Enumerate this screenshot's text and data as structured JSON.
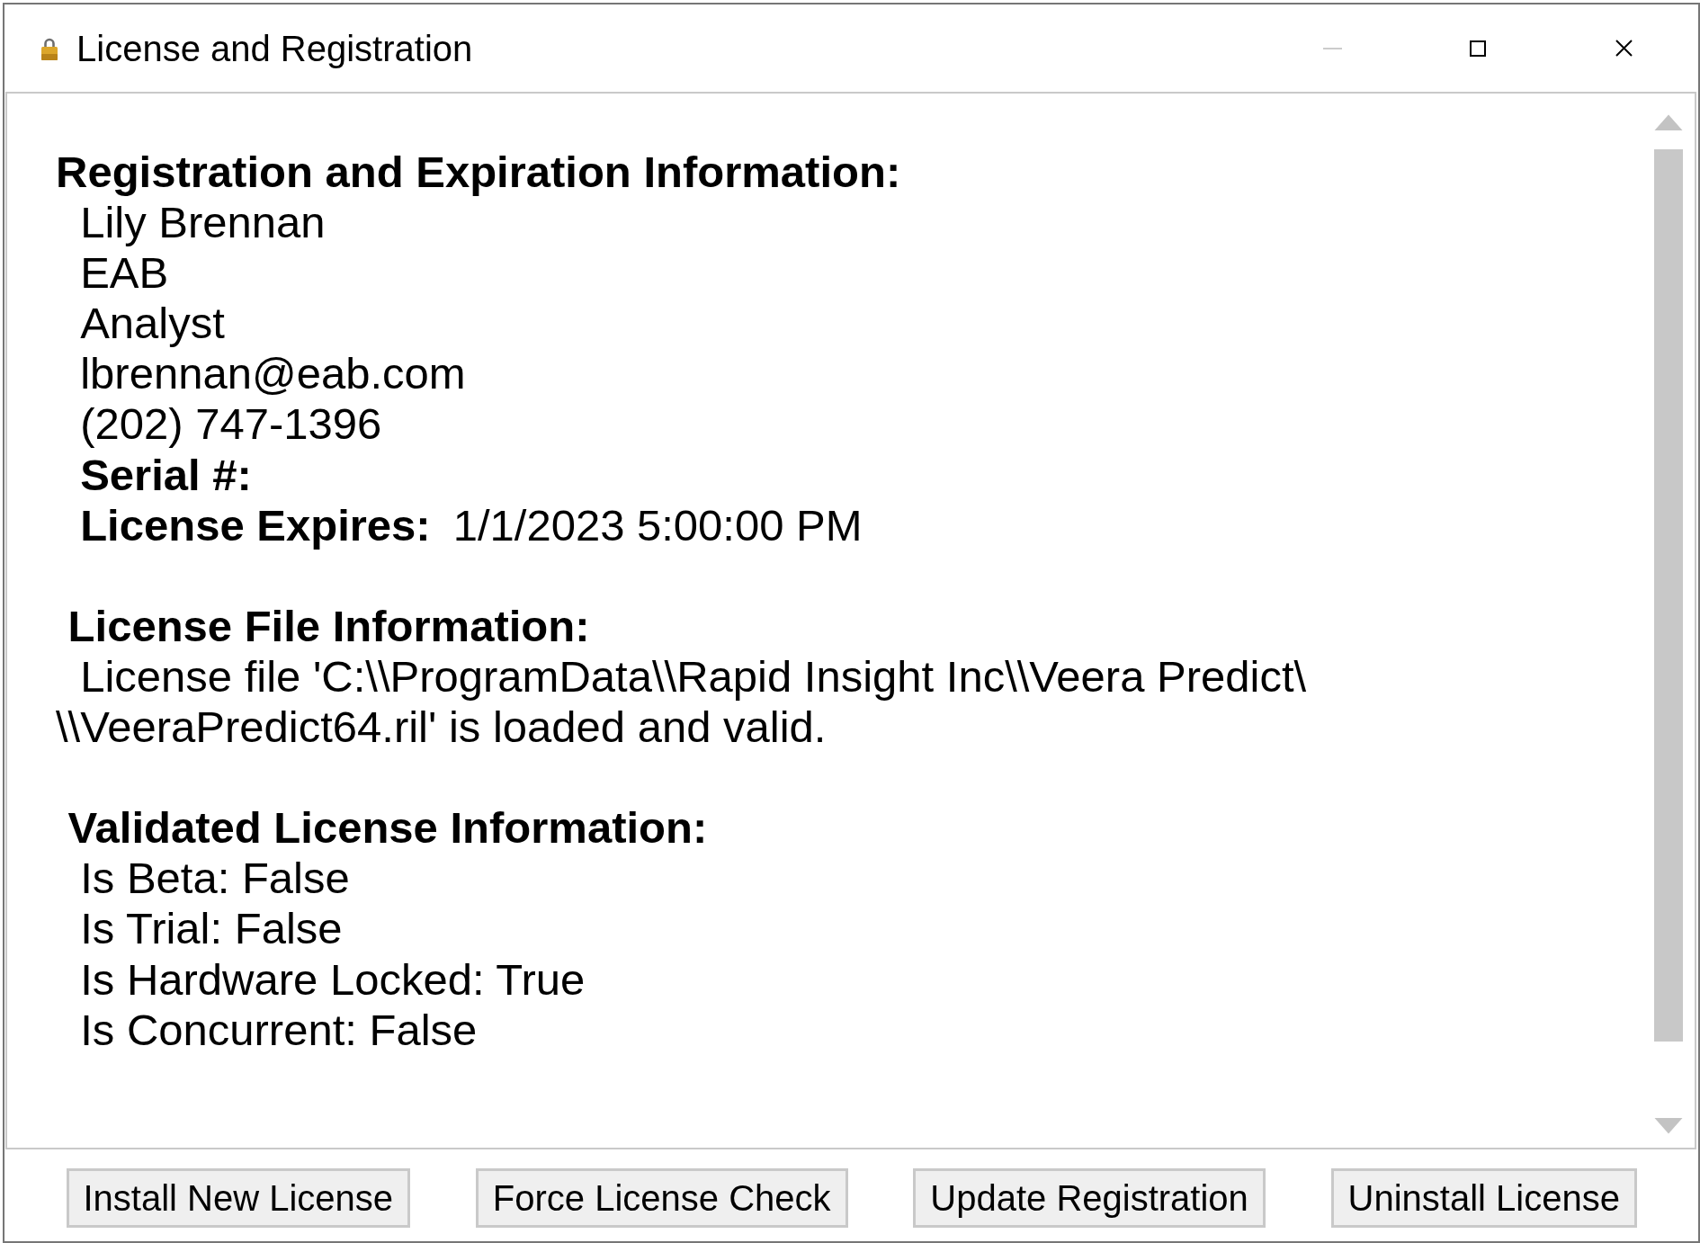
{
  "window": {
    "title": "License and Registration",
    "controls": [
      {
        "kind": "minimize",
        "disabled": true
      },
      {
        "kind": "maximize",
        "disabled": false
      },
      {
        "kind": "close",
        "disabled": false
      }
    ]
  },
  "sections": [
    {
      "heading": "Registration and Expiration Information:",
      "lines": [
        {
          "kind": "text",
          "text": "Lily Brennan"
        },
        {
          "kind": "text",
          "text": "EAB"
        },
        {
          "kind": "text",
          "text": "Analyst"
        },
        {
          "kind": "text",
          "text": "lbrennan@eab.com"
        },
        {
          "kind": "text",
          "text": "(202) 747-1396"
        },
        {
          "kind": "field",
          "label": "Serial #:"
        },
        {
          "kind": "field",
          "label": "License Expires:",
          "value": "1/1/2023 5:00:00 PM"
        }
      ]
    },
    {
      "heading": "License File Information:",
      "lines": [
        {
          "kind": "paragraph",
          "text": "License file 'C:\\\\ProgramData\\\\Rapid Insight Inc\\\\Veera Predict\\\\\\VeeraPredict64.ril' is loaded and valid."
        }
      ]
    },
    {
      "heading": "Validated License Information:",
      "lines": [
        {
          "kind": "text",
          "text": "Is Beta: False"
        },
        {
          "kind": "text",
          "text": "Is Trial: False"
        },
        {
          "kind": "text",
          "text": "Is Hardware Locked: True"
        },
        {
          "kind": "text",
          "text": "Is Concurrent: False"
        }
      ]
    }
  ],
  "buttons": [
    {
      "label": "Install New License"
    },
    {
      "label": "Force License Check"
    },
    {
      "label": "Update Registration"
    },
    {
      "label": "Uninstall License"
    }
  ]
}
